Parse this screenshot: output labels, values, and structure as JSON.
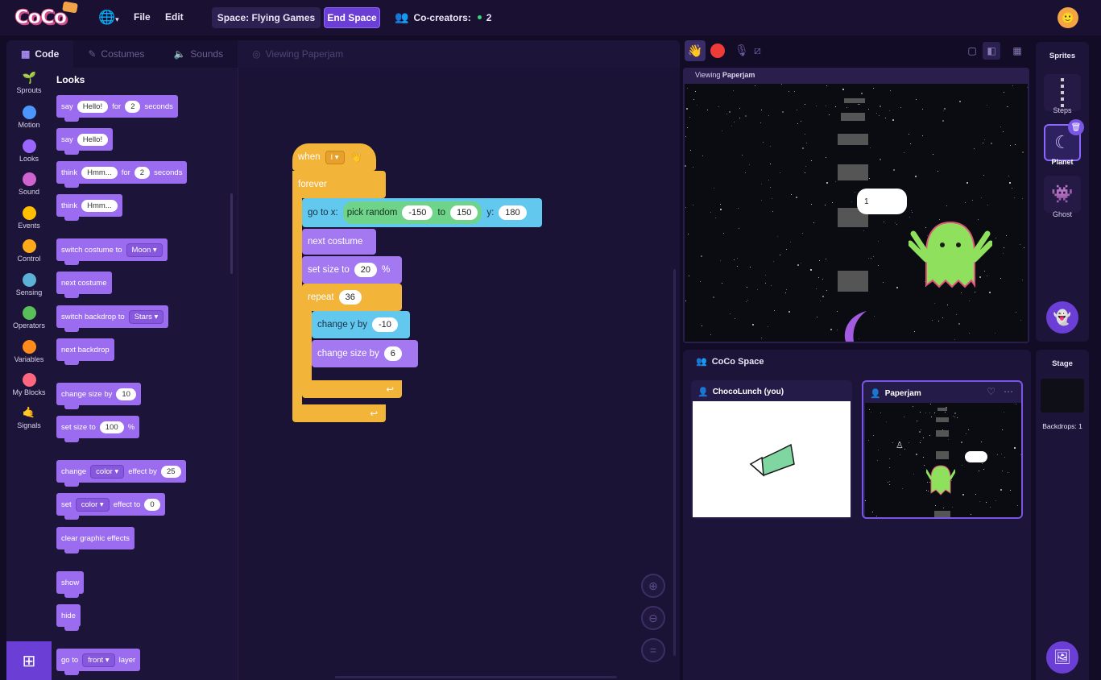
{
  "topbar": {
    "logo": "CoCo",
    "menu_file": "File",
    "menu_edit": "Edit",
    "space_label": "Space: Flying Games",
    "end_space": "End Space",
    "cocreators_label": "Co-creators:",
    "cocreators_count": "2"
  },
  "tabs": {
    "code": "Code",
    "costumes": "Costumes",
    "sounds": "Sounds",
    "viewing": "Viewing Paperjam"
  },
  "categories": [
    {
      "label": "Sprouts",
      "color": "#3fbf55"
    },
    {
      "label": "Motion",
      "color": "#4c97ff"
    },
    {
      "label": "Looks",
      "color": "#9966ff"
    },
    {
      "label": "Sound",
      "color": "#cf63cf"
    },
    {
      "label": "Events",
      "color": "#ffbf00"
    },
    {
      "label": "Control",
      "color": "#ffab19"
    },
    {
      "label": "Sensing",
      "color": "#5cb1d6"
    },
    {
      "label": "Operators",
      "color": "#59c059"
    },
    {
      "label": "Variables",
      "color": "#ff8c1a"
    },
    {
      "label": "My Blocks",
      "color": "#ff6680"
    },
    {
      "label": "Signals",
      "color": "#ffffff"
    }
  ],
  "palette": {
    "title": "Looks",
    "say_for": {
      "say": "say",
      "msg": "Hello!",
      "for": "for",
      "secs": "2",
      "seconds": "seconds"
    },
    "say": {
      "say": "say",
      "msg": "Hello!"
    },
    "think_for": {
      "think": "think",
      "msg": "Hmm...",
      "for": "for",
      "secs": "2",
      "seconds": "seconds"
    },
    "think": {
      "think": "think",
      "msg": "Hmm..."
    },
    "switch_costume": {
      "label": "switch costume to",
      "value": "Moon"
    },
    "next_costume": "next costume",
    "switch_backdrop": {
      "label": "switch backdrop to",
      "value": "Stars"
    },
    "next_backdrop": "next backdrop",
    "change_size": {
      "label": "change size by",
      "value": "10"
    },
    "set_size": {
      "label": "set size to",
      "value": "100",
      "unit": "%"
    },
    "change_effect": {
      "change": "change",
      "effect": "color",
      "label": "effect by",
      "value": "25"
    },
    "set_effect": {
      "set": "set",
      "effect": "color",
      "label": "effect to",
      "value": "0"
    },
    "clear_effects": "clear graphic effects",
    "show": "show",
    "hide": "hide",
    "go_to_layer": {
      "goto": "go to",
      "value": "front",
      "layer": "layer"
    }
  },
  "script": {
    "when": "when",
    "when_key": "I",
    "forever": "forever",
    "goto_x": "go to x:",
    "pick_random": "pick random",
    "rand_from": "-150",
    "rand_to_label": "to",
    "rand_to": "150",
    "y_label": "y:",
    "y_value": "180",
    "next_costume": "next costume",
    "set_size": "set size to",
    "set_size_value": "20",
    "set_size_unit": "%",
    "repeat": "repeat",
    "repeat_value": "36",
    "change_y": "change y by",
    "change_y_value": "-10",
    "change_size": "change size by",
    "change_size_value": "6"
  },
  "stage": {
    "viewing_prefix": "Viewing",
    "viewing_name": "Paperjam",
    "bubble_text": "1"
  },
  "sprites": {
    "title": "Sprites",
    "items": [
      {
        "name": "Steps"
      },
      {
        "name": "Planet"
      },
      {
        "name": "Ghost"
      }
    ]
  },
  "space": {
    "title": "CoCo Space",
    "cards": [
      {
        "name": "ChocoLunch (you)"
      },
      {
        "name": "Paperjam"
      }
    ]
  },
  "stage_col": {
    "title": "Stage",
    "backdrops_label": "Backdrops: 1"
  },
  "colors": {
    "accent": "#6b3fd6",
    "looks": "#9b6cf0",
    "control": "#f3b43a",
    "motion": "#6fb0ff",
    "operators": "#6fd38a",
    "record": "#ef3a3a"
  }
}
